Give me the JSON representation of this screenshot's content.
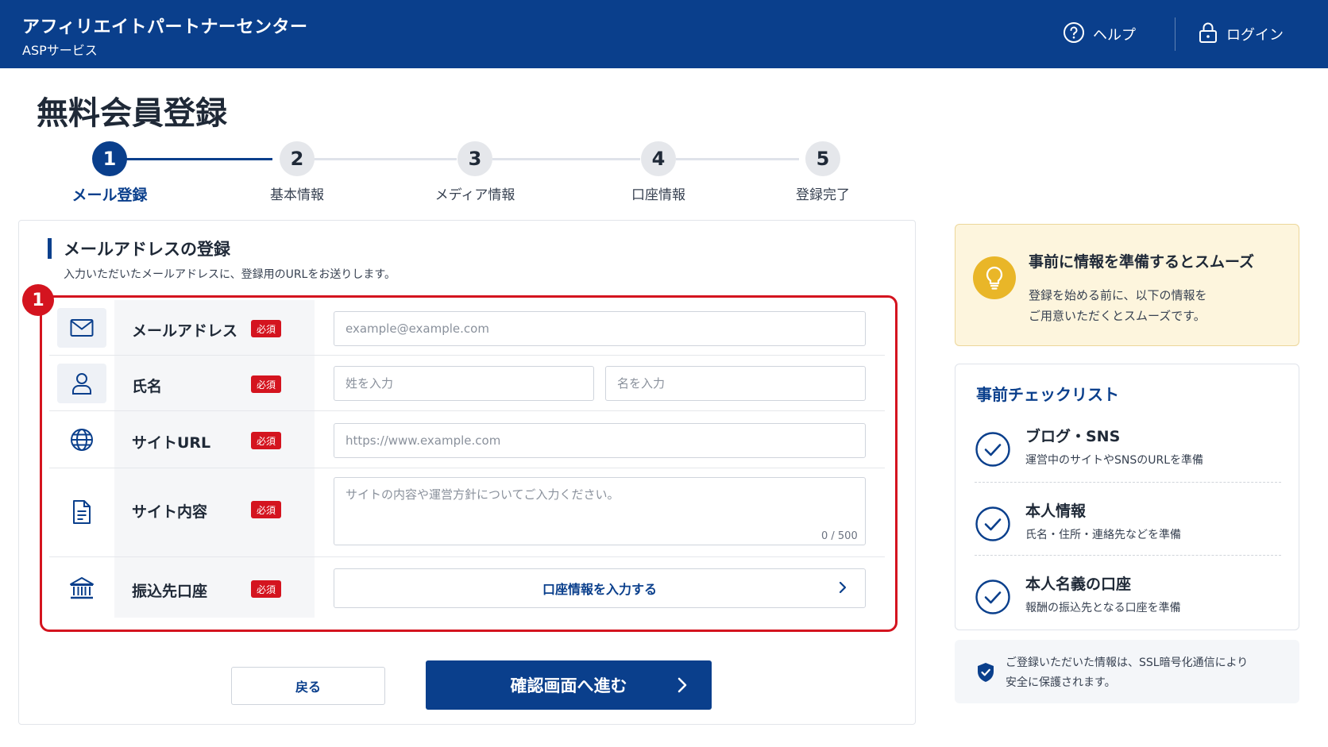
{
  "header": {
    "title": "アフィリエイトパートナーセンター",
    "subtitle": "ASPサービス",
    "help_label": "ヘルプ",
    "login_label": "ログイン"
  },
  "page": {
    "title": "無料会員登録"
  },
  "steps": [
    {
      "num": "1",
      "label": "メール登録",
      "active": true
    },
    {
      "num": "2",
      "label": "基本情報",
      "active": false
    },
    {
      "num": "3",
      "label": "メディア情報",
      "active": false
    },
    {
      "num": "4",
      "label": "口座情報",
      "active": false
    },
    {
      "num": "5",
      "label": "登録完了",
      "active": false
    }
  ],
  "form": {
    "section_title": "メールアドレスの登録",
    "section_desc": "入力いただいたメールアドレスに、登録用のURLをお送りします。",
    "annotation_number": "1",
    "required_label": "必須",
    "email": {
      "label": "メールアドレス",
      "placeholder": "example@example.com",
      "icon": "mail-icon"
    },
    "name": {
      "label": "氏名",
      "last_placeholder": "姓を入力",
      "first_placeholder": "名を入力",
      "icon": "user-icon"
    },
    "site_url": {
      "label": "サイトURL",
      "placeholder": "https://www.example.com",
      "icon": "globe-icon"
    },
    "site_content": {
      "label": "サイト内容",
      "placeholder": "サイトの内容や運営方針についてご入力ください。",
      "counter": "0 / 500",
      "icon": "document-icon"
    },
    "bank": {
      "label": "振込先口座",
      "button_label": "口座情報を入力する",
      "icon": "bank-icon"
    }
  },
  "actions": {
    "back_label": "戻る",
    "next_label": "確認画面へ進む"
  },
  "tip": {
    "title": "事前に情報を準備するとスムーズ",
    "line1": "登録を始める前に、以下の情報を",
    "line2": "ご用意いただくとスムーズです。"
  },
  "checklist": {
    "heading": "事前チェックリスト",
    "items": [
      {
        "title": "ブログ・SNS",
        "desc": "運営中のサイトやSNSのURLを準備"
      },
      {
        "title": "本人情報",
        "desc": "氏名・住所・連絡先などを準備"
      },
      {
        "title": "本人名義の口座",
        "desc": "報酬の振込先となる口座を準備"
      }
    ]
  },
  "security": {
    "line1": "ご登録いただいた情報は、SSL暗号化通信により",
    "line2": "安全に保護されます。"
  },
  "colors": {
    "primary": "#0a3f8c",
    "required": "#d4141f",
    "tip_bg": "#fdf5dd",
    "tip_icon": "#e9b628"
  }
}
